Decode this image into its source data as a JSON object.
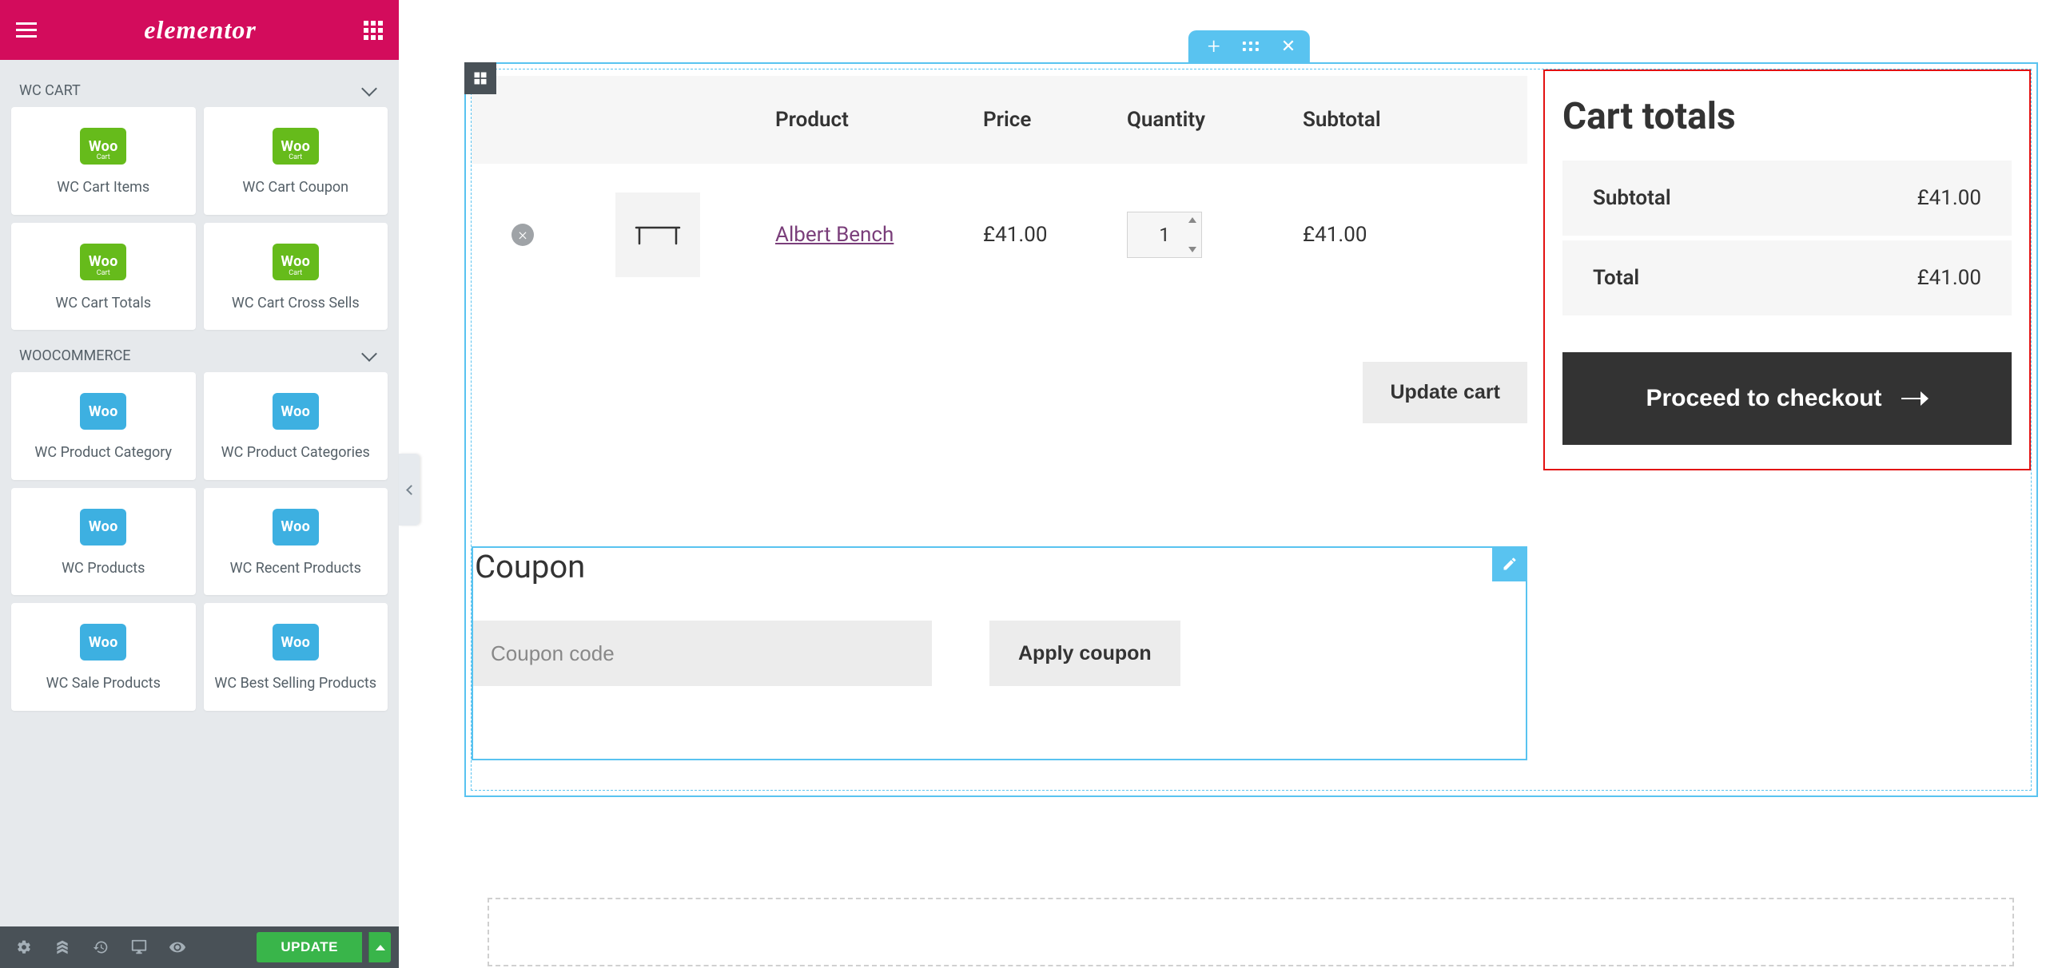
{
  "sidebar": {
    "brand": "elementor",
    "categories": [
      {
        "name": "WC CART",
        "widgets": [
          {
            "label": "WC Cart Items",
            "style": "green",
            "sub": "Cart"
          },
          {
            "label": "WC Cart Coupon",
            "style": "green",
            "sub": "Cart"
          },
          {
            "label": "WC Cart Totals",
            "style": "green",
            "sub": "Cart"
          },
          {
            "label": "WC Cart Cross Sells",
            "style": "green",
            "sub": "Cart"
          }
        ]
      },
      {
        "name": "WOOCOMMERCE",
        "widgets": [
          {
            "label": "WC Product Category",
            "style": "blue"
          },
          {
            "label": "WC Product Categories",
            "style": "blue"
          },
          {
            "label": "WC Products",
            "style": "blue"
          },
          {
            "label": "WC Recent Products",
            "style": "blue"
          },
          {
            "label": "WC Sale Products",
            "style": "blue"
          },
          {
            "label": "WC Best Selling Products",
            "style": "blue"
          }
        ]
      }
    ],
    "woo_badge_text": "Woo",
    "publish_btn": "UPDATE"
  },
  "cart": {
    "headers": {
      "product": "Product",
      "price": "Price",
      "quantity": "Quantity",
      "subtotal": "Subtotal"
    },
    "item": {
      "name": "Albert Bench",
      "price": "£41.00",
      "qty": "1",
      "subtotal": "£41.00"
    },
    "update_btn": "Update cart"
  },
  "coupon": {
    "title": "Coupon",
    "placeholder": "Coupon code",
    "apply_btn": "Apply coupon"
  },
  "totals": {
    "title": "Cart totals",
    "subtotal_label": "Subtotal",
    "subtotal_value": "£41.00",
    "total_label": "Total",
    "total_value": "£41.00",
    "checkout_btn": "Proceed to checkout"
  }
}
